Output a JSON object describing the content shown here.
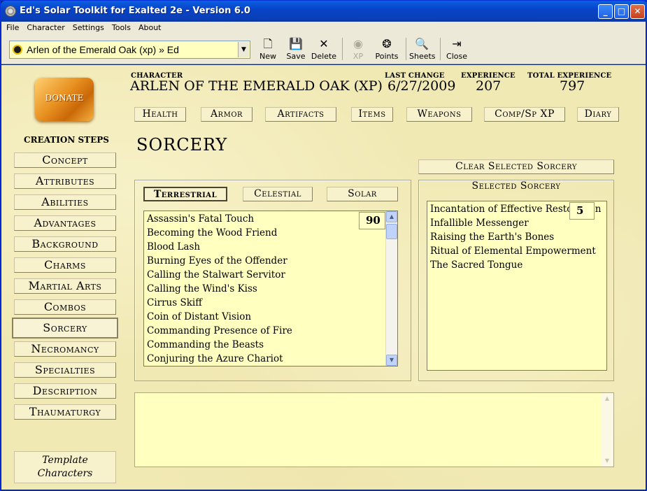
{
  "window": {
    "title": "Ed's Solar Toolkit for Exalted 2e - Version 6.0",
    "buttons": {
      "minimize": "_",
      "maximize": "□",
      "close": "✕"
    }
  },
  "menu": [
    "File",
    "Character",
    "Settings",
    "Tools",
    "About"
  ],
  "toolbar": {
    "character": "Arlen of the Emerald Oak (xp) » Ed",
    "buttons": [
      {
        "label": "New",
        "icon": "new-document-icon",
        "glyph": "🗋"
      },
      {
        "label": "Save",
        "icon": "save-icon",
        "glyph": "💾"
      },
      {
        "label": "Delete",
        "icon": "delete-icon",
        "glyph": "✕"
      },
      {
        "label": "XP",
        "icon": "xp-icon",
        "glyph": "◉"
      },
      {
        "label": "Points",
        "icon": "points-icon",
        "glyph": "❂"
      },
      {
        "label": "Sheets",
        "icon": "sheets-icon",
        "glyph": "🔍"
      },
      {
        "label": "Close",
        "icon": "close-door-icon",
        "glyph": "⇥"
      }
    ]
  },
  "donate": "DONATE",
  "header": {
    "character_label": "CHARACTER",
    "character_name": "ARLEN OF THE EMERALD OAK (XP)",
    "last_change_label": "LAST CHANGE",
    "last_change": "6/27/2009",
    "experience_label": "EXPERIENCE",
    "experience": "207",
    "total_experience_label": "TOTAL EXPERIENCE",
    "total_experience": "797"
  },
  "nav_tabs": [
    "Health",
    "Armor",
    "Artifacts",
    "Items",
    "Weapons",
    "Comp/Sp XP",
    "Diary"
  ],
  "steps_title": "CREATION STEPS",
  "steps": [
    "Concept",
    "Attributes",
    "Abilities",
    "Advantages",
    "Background",
    "Charms",
    "Martial Arts",
    "Combos",
    "Sorcery",
    "Necromancy",
    "Specialties",
    "Description",
    "Thaumaturgy"
  ],
  "active_step": "Sorcery",
  "template_button": [
    "Template",
    "Characters"
  ],
  "section_title": "SORCERY",
  "clear_button": "Clear Selected Sorcery",
  "circle_tabs": [
    "Terrestrial",
    "Celestial",
    "Solar"
  ],
  "available_spells": [
    "Assassin's Fatal Touch",
    "Becoming the Wood Friend",
    "Blood Lash",
    "Burning Eyes of the Offender",
    "Calling the Stalwart Servitor",
    "Calling the Wind's Kiss",
    "Cirrus Skiff",
    "Coin of Distant Vision",
    "Commanding Presence of Fire",
    "Commanding the Beasts",
    "Conjuring the Azure Chariot"
  ],
  "available_cost": "90",
  "selected_header": "Selected Sorcery",
  "selected_spells": [
    "Incantation of Effective Restoration",
    "Infallible Messenger",
    "Raising the Earth's Bones",
    "Ritual of Elemental Empowerment",
    "The Sacred Tongue"
  ],
  "selected_cost": "5",
  "colors": {
    "parchment": "#f1e9b4",
    "list_bg": "#ffffc0",
    "title_blue": "#0844c8"
  }
}
